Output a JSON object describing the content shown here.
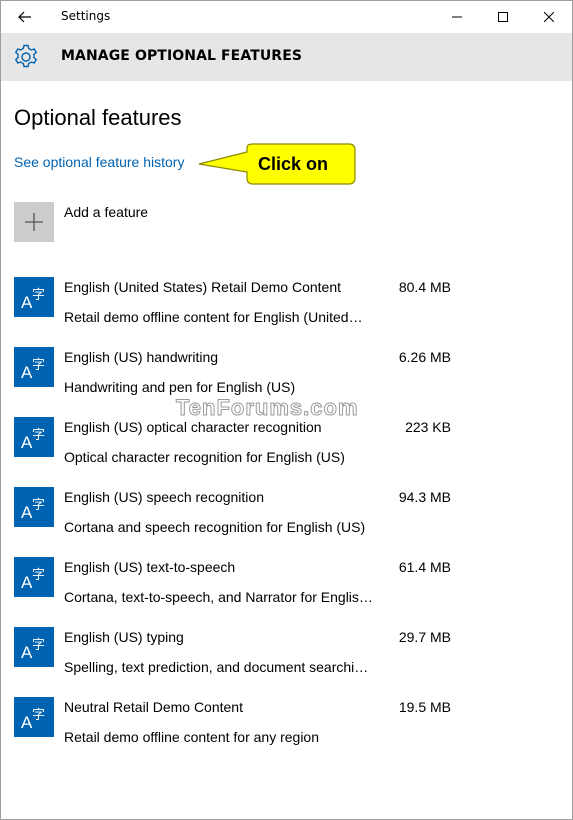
{
  "window": {
    "title": "Settings"
  },
  "header": {
    "title": "MANAGE OPTIONAL FEATURES",
    "icon": "gear-icon"
  },
  "page": {
    "title": "Optional features",
    "history_link": "See optional feature history",
    "add_feature": "Add a feature"
  },
  "callout": {
    "text": "Click on",
    "fill": "#ffff00"
  },
  "watermark": "TenForums.com",
  "features": [
    {
      "name": "English (United States) Retail Demo Content",
      "size": "80.4 MB",
      "description": "Retail demo offline content for English (United…"
    },
    {
      "name": "English (US) handwriting",
      "size": "6.26 MB",
      "description": "Handwriting and pen for English (US)"
    },
    {
      "name": "English (US) optical character recognition",
      "size": "223 KB",
      "description": "Optical character recognition for English (US)"
    },
    {
      "name": "English (US) speech recognition",
      "size": "94.3 MB",
      "description": "Cortana and speech recognition for English (US)"
    },
    {
      "name": "English (US) text-to-speech",
      "size": "61.4 MB",
      "description": "Cortana, text-to-speech, and Narrator for Englis…"
    },
    {
      "name": "English (US) typing",
      "size": "29.7 MB",
      "description": "Spelling, text prediction, and document searchi…"
    },
    {
      "name": "Neutral Retail Demo Content",
      "size": "19.5 MB",
      "description": "Retail demo offline content for any region"
    }
  ],
  "colors": {
    "accent": "#0063b1",
    "header_bg": "#e6e6e6",
    "add_tile": "#cccccc"
  }
}
